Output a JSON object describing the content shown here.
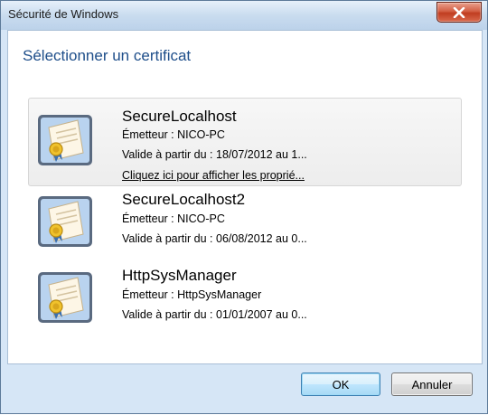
{
  "window": {
    "title": "Sécurité de Windows"
  },
  "dialog": {
    "heading": "Sélectionner un certificat"
  },
  "certificates": [
    {
      "name": "SecureLocalhost",
      "issuer": "Émetteur : NICO-PC",
      "valid": "Valide à partir du : 18/07/2012 au 1...",
      "link": "Cliquez ici pour afficher les proprié...",
      "selected": true
    },
    {
      "name": "SecureLocalhost2",
      "issuer": "Émetteur : NICO-PC",
      "valid": "Valide à partir du : 06/08/2012 au 0..."
    },
    {
      "name": "HttpSysManager",
      "issuer": "Émetteur : HttpSysManager",
      "valid": "Valide à partir du : 01/01/2007 au 0..."
    }
  ],
  "buttons": {
    "ok": "OK",
    "cancel": "Annuler"
  },
  "colors": {
    "heading": "#1e4e8a",
    "close": "#c03d20",
    "default_button_border": "#3c7fb1"
  }
}
